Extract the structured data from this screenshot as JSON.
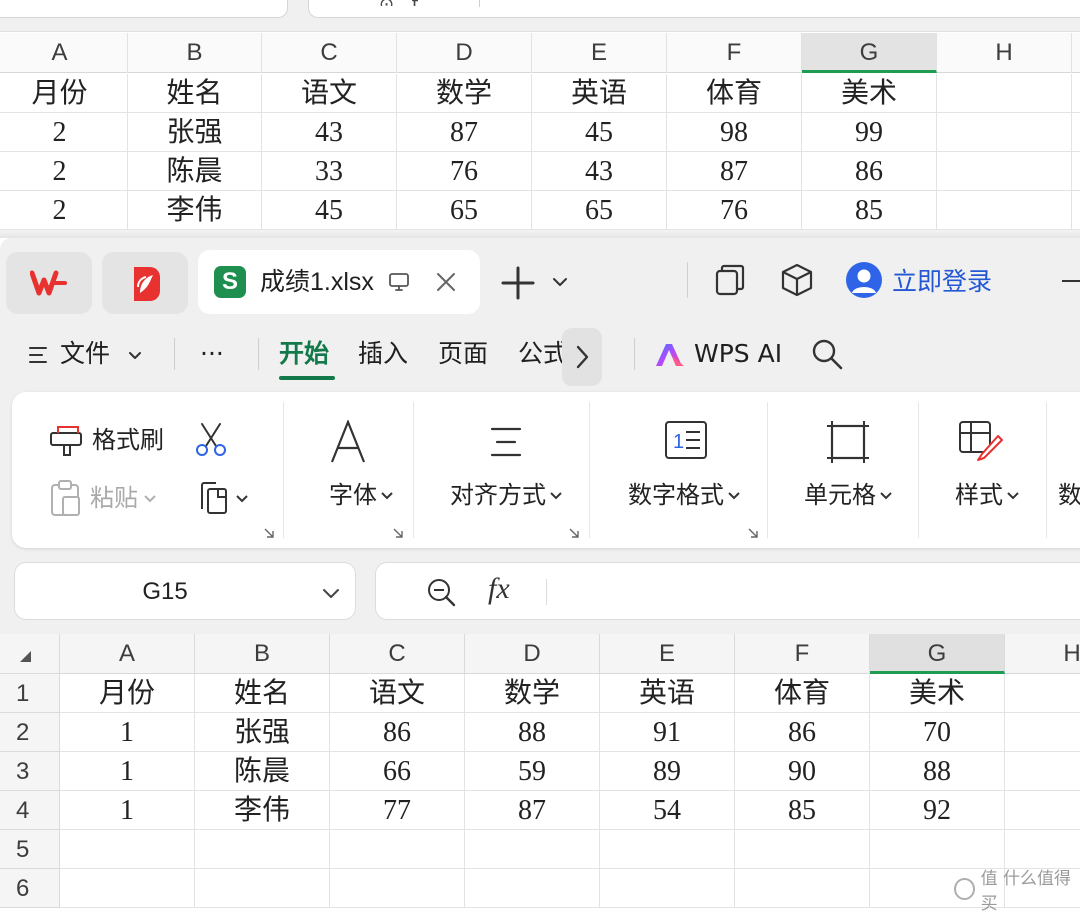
{
  "bg_sheet": {
    "columns": [
      "A",
      "B",
      "C",
      "D",
      "E",
      "F",
      "G",
      "H"
    ],
    "selected_column": "G",
    "rows": [
      [
        "月份",
        "姓名",
        "语文",
        "数学",
        "英语",
        "体育",
        "美术"
      ],
      [
        "2",
        "张强",
        "43",
        "87",
        "45",
        "98",
        "99"
      ],
      [
        "2",
        "陈晨",
        "33",
        "76",
        "43",
        "87",
        "86"
      ],
      [
        "2",
        "李伟",
        "45",
        "65",
        "65",
        "76",
        "85"
      ]
    ]
  },
  "titlebar": {
    "wps_logo": "W",
    "doc_tab_title": "成绩1.xlsx",
    "doc_tab_icon": "S",
    "login_label": "立即登录"
  },
  "menu": {
    "file": "文件",
    "more": "···",
    "home": "开始",
    "insert": "插入",
    "page": "页面",
    "formula_truncated": "公式",
    "wps_ai": "WPS AI"
  },
  "ribbon": {
    "format_painter": "格式刷",
    "paste": "粘贴",
    "font": "字体",
    "alignment": "对齐方式",
    "number_format": "数字格式",
    "cells": "单元格",
    "styles": "样式",
    "clipped_next": "数"
  },
  "namebox": {
    "value": "G15"
  },
  "formula": {
    "fx": "fx",
    "value": ""
  },
  "sheet": {
    "columns": [
      "A",
      "B",
      "C",
      "D",
      "E",
      "F",
      "G",
      "H"
    ],
    "selected_column": "G",
    "row_numbers": [
      "1",
      "2",
      "3",
      "4",
      "5",
      "6"
    ],
    "rows": [
      [
        "月份",
        "姓名",
        "语文",
        "数学",
        "英语",
        "体育",
        "美术"
      ],
      [
        "1",
        "张强",
        "86",
        "88",
        "91",
        "86",
        "70"
      ],
      [
        "1",
        "陈晨",
        "66",
        "59",
        "89",
        "90",
        "88"
      ],
      [
        "1",
        "李伟",
        "77",
        "87",
        "54",
        "85",
        "92"
      ]
    ]
  },
  "watermark": "值 什么值得买",
  "colors": {
    "accent_green": "#14794a",
    "select_green": "#1e9c52",
    "login_blue": "#2457d6",
    "wps_red": "#e8322f"
  }
}
